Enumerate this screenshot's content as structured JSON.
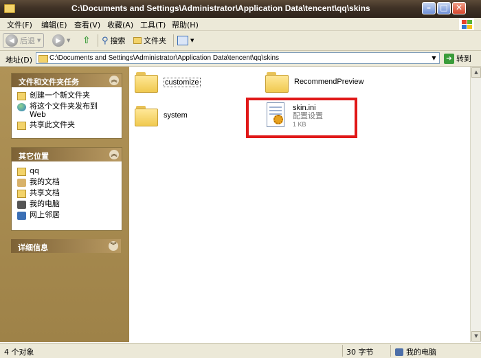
{
  "window": {
    "title": "C:\\Documents and Settings\\Administrator\\Application Data\\tencent\\qq\\skins",
    "buttons": {
      "minimize": "–",
      "maximize": "□",
      "close": "✕"
    }
  },
  "menu": {
    "items": [
      "文件(F)",
      "编辑(E)",
      "查看(V)",
      "收藏(A)",
      "工具(T)",
      "帮助(H)"
    ]
  },
  "toolbar": {
    "back": "后退",
    "search": "搜索",
    "folders": "文件夹"
  },
  "address": {
    "label": "地址(D)",
    "path": "C:\\Documents and Settings\\Administrator\\Application Data\\tencent\\qq\\skins",
    "go": "转到"
  },
  "sidebar": {
    "tasks": {
      "title": "文件和文件夹任务",
      "items": [
        "创建一个新文件夹",
        "将这个文件夹发布到 Web",
        "共享此文件夹"
      ]
    },
    "places": {
      "title": "其它位置",
      "items": [
        "qq",
        "我的文档",
        "共享文档",
        "我的电脑",
        "网上邻居"
      ]
    },
    "details": {
      "title": "详细信息"
    }
  },
  "files": [
    {
      "name": "customize",
      "kind": "folder"
    },
    {
      "name": "RecommendPreview",
      "kind": "folder"
    },
    {
      "name": "system",
      "kind": "folder"
    },
    {
      "name": "skin.ini",
      "kind": "file",
      "type": "配置设置",
      "size": "1 KB"
    }
  ],
  "status": {
    "count": "4 个对象",
    "size": "30 字节",
    "location": "我的电脑"
  },
  "colors": {
    "highlight": "#e01818",
    "sidebar": "#a68a51"
  }
}
